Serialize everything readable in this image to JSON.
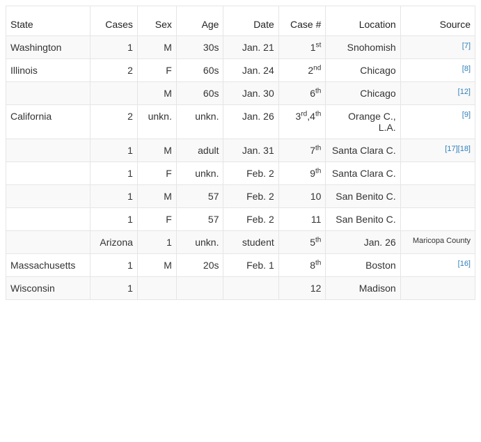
{
  "headers": {
    "state": "State",
    "cases": "Cases",
    "sex": "Sex",
    "age": "Age",
    "date": "Date",
    "casenum": "Case #",
    "location": "Location",
    "source": "Source"
  },
  "rows": [
    {
      "state": "Washington",
      "cases": "1",
      "sex": "M",
      "age": "30s",
      "date": "Jan. 21",
      "casenum": "1",
      "case_suffix": "st",
      "location": "Snohomish",
      "sources": [
        "7"
      ]
    },
    {
      "state": "Illinois",
      "cases": "2",
      "sex": "F",
      "age": "60s",
      "date": "Jan. 24",
      "casenum": "2",
      "case_suffix": "nd",
      "location": "Chicago",
      "sources": [
        "8"
      ]
    },
    {
      "state": "",
      "cases": "",
      "sex": "M",
      "age": "60s",
      "date": "Jan. 30",
      "casenum": "6",
      "case_suffix": "th",
      "location": "Chicago",
      "sources": [
        "12"
      ]
    },
    {
      "state": "California",
      "cases": "2",
      "sex": "unkn.",
      "age": "unkn.",
      "date": "Jan. 26",
      "casenum_raw": "3rd,4th",
      "location": "Orange C., L.A.",
      "sources": [
        "9"
      ]
    },
    {
      "state": "",
      "cases": "1",
      "sex": "M",
      "age": "adult",
      "date": "Jan. 31",
      "casenum": "7",
      "case_suffix": "th",
      "location": "Santa Clara C.",
      "sources": [
        "17",
        "18"
      ]
    },
    {
      "state": "",
      "cases": "1",
      "sex": "F",
      "age": "unkn.",
      "date": "Feb. 2",
      "casenum": "9",
      "case_suffix": "th",
      "location": "Santa Clara C.",
      "sources": []
    },
    {
      "state": "",
      "cases": "1",
      "sex": "M",
      "age": "57",
      "date": "Feb. 2",
      "casenum": "10",
      "case_suffix": "",
      "location": "San Benito C.",
      "sources": []
    },
    {
      "state": "",
      "cases": "1",
      "sex": "F",
      "age": "57",
      "date": "Feb. 2",
      "casenum": "11",
      "case_suffix": "",
      "location": "San Benito C.",
      "sources": []
    },
    {
      "state": "",
      "cases": "Arizona",
      "sex": "1",
      "age": "unkn.",
      "date": "student",
      "casenum": "5",
      "case_suffix": "th",
      "location": "Jan. 26",
      "source_text": "Maricopa County"
    },
    {
      "state": "Massachusetts",
      "cases": "1",
      "sex": "M",
      "age": "20s",
      "date": "Feb. 1",
      "casenum": "8",
      "case_suffix": "th",
      "location": "Boston",
      "sources": [
        "16"
      ]
    },
    {
      "state": "Wisconsin",
      "cases": "1",
      "sex": "",
      "age": "",
      "date": "",
      "casenum": "12",
      "case_suffix": "",
      "location": "Madison",
      "sources": []
    }
  ]
}
